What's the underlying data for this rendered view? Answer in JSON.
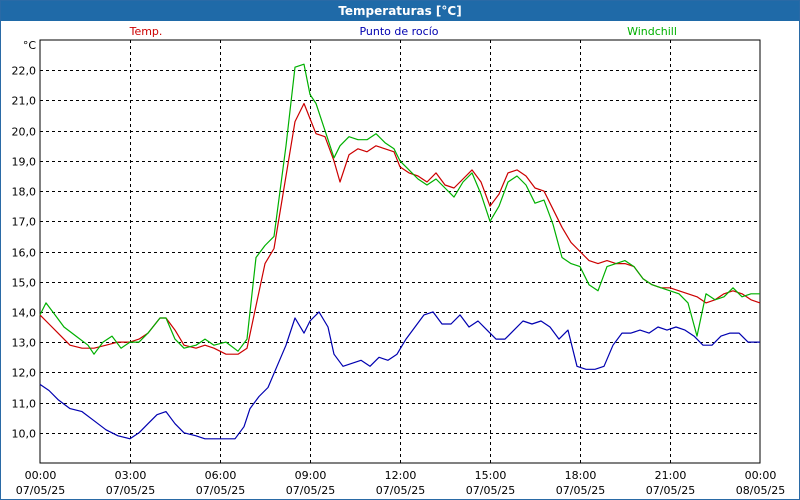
{
  "window": {
    "title": "Temperaturas [°C]"
  },
  "chart_data": {
    "type": "line",
    "title": "Temperaturas [°C]",
    "unit_label": "°C",
    "xlim": [
      0,
      24
    ],
    "ylim": [
      9.0,
      23.0
    ],
    "y_ticks": [
      10.0,
      11.0,
      12.0,
      13.0,
      14.0,
      15.0,
      16.0,
      17.0,
      18.0,
      19.0,
      20.0,
      21.0,
      22.0
    ],
    "y_tick_labels": [
      "10,0",
      "11,0",
      "12,0",
      "13,0",
      "14,0",
      "15,0",
      "16,0",
      "17,0",
      "18,0",
      "19,0",
      "20,0",
      "21,0",
      "22,0"
    ],
    "x_ticks": [
      0,
      3,
      6,
      9,
      12,
      15,
      18,
      21,
      24
    ],
    "x_tick_labels": [
      [
        "00:00",
        "07/05/25"
      ],
      [
        "03:00",
        "07/05/25"
      ],
      [
        "06:00",
        "07/05/25"
      ],
      [
        "09:00",
        "07/05/25"
      ],
      [
        "12:00",
        "07/05/25"
      ],
      [
        "15:00",
        "07/05/25"
      ],
      [
        "18:00",
        "07/05/25"
      ],
      [
        "21:00",
        "07/05/25"
      ],
      [
        "00:00",
        "08/05/25"
      ]
    ],
    "grid": true,
    "legend_position": "top",
    "series": [
      {
        "name": "Temp.",
        "color": "#cc0000",
        "x": [
          0,
          0.3,
          0.6,
          1.0,
          1.4,
          1.8,
          2.2,
          2.6,
          3.0,
          3.3,
          3.6,
          4.0,
          4.2,
          4.5,
          4.8,
          5.2,
          5.5,
          5.8,
          6.2,
          6.6,
          6.9,
          7.2,
          7.5,
          7.8,
          8.2,
          8.5,
          8.8,
          9.0,
          9.2,
          9.5,
          9.8,
          10.0,
          10.3,
          10.6,
          10.9,
          11.2,
          11.5,
          11.8,
          12.0,
          12.3,
          12.6,
          12.9,
          13.2,
          13.5,
          13.8,
          14.1,
          14.4,
          14.7,
          15.0,
          15.3,
          15.6,
          15.9,
          16.2,
          16.5,
          16.8,
          17.1,
          17.4,
          17.7,
          18.0,
          18.3,
          18.6,
          18.9,
          19.2,
          19.5,
          19.8,
          20.1,
          20.4,
          20.7,
          21.0,
          21.3,
          21.6,
          21.9,
          22.2,
          22.5,
          22.8,
          23.1,
          23.4,
          23.7,
          24.0
        ],
        "values": [
          13.9,
          13.6,
          13.3,
          12.9,
          12.8,
          12.8,
          12.9,
          13.0,
          13.0,
          13.1,
          13.3,
          13.8,
          13.8,
          13.4,
          12.9,
          12.8,
          12.9,
          12.8,
          12.6,
          12.6,
          12.8,
          14.2,
          15.6,
          16.1,
          18.5,
          20.3,
          20.9,
          20.4,
          19.9,
          19.8,
          19.0,
          18.3,
          19.2,
          19.4,
          19.3,
          19.5,
          19.4,
          19.3,
          18.8,
          18.6,
          18.5,
          18.3,
          18.6,
          18.2,
          18.1,
          18.4,
          18.7,
          18.3,
          17.5,
          17.9,
          18.6,
          18.7,
          18.5,
          18.1,
          18.0,
          17.4,
          16.8,
          16.3,
          16.0,
          15.7,
          15.6,
          15.7,
          15.6,
          15.6,
          15.5,
          15.1,
          14.9,
          14.8,
          14.8,
          14.7,
          14.6,
          14.5,
          14.3,
          14.4,
          14.6,
          14.7,
          14.6,
          14.4,
          14.3
        ]
      },
      {
        "name": "Punto de rocío",
        "color": "#0000b0",
        "x": [
          0,
          0.3,
          0.6,
          1.0,
          1.4,
          1.8,
          2.2,
          2.6,
          3.0,
          3.3,
          3.6,
          3.9,
          4.2,
          4.5,
          4.8,
          5.2,
          5.5,
          5.8,
          6.2,
          6.5,
          6.8,
          7.0,
          7.3,
          7.6,
          7.9,
          8.2,
          8.5,
          8.8,
          9.0,
          9.3,
          9.6,
          9.8,
          10.1,
          10.4,
          10.7,
          11.0,
          11.3,
          11.6,
          11.9,
          12.2,
          12.5,
          12.8,
          13.1,
          13.4,
          13.7,
          14.0,
          14.3,
          14.6,
          14.9,
          15.2,
          15.5,
          15.8,
          16.1,
          16.4,
          16.7,
          17.0,
          17.3,
          17.6,
          17.9,
          18.2,
          18.5,
          18.8,
          19.1,
          19.4,
          19.7,
          20.0,
          20.3,
          20.6,
          20.9,
          21.2,
          21.5,
          21.8,
          22.1,
          22.4,
          22.7,
          23.0,
          23.3,
          23.6,
          24.0
        ],
        "values": [
          11.6,
          11.4,
          11.1,
          10.8,
          10.7,
          10.4,
          10.1,
          9.9,
          9.8,
          10.0,
          10.3,
          10.6,
          10.7,
          10.3,
          10.0,
          9.9,
          9.8,
          9.8,
          9.8,
          9.8,
          10.2,
          10.8,
          11.2,
          11.5,
          12.2,
          12.9,
          13.8,
          13.3,
          13.7,
          14.0,
          13.5,
          12.6,
          12.2,
          12.3,
          12.4,
          12.2,
          12.5,
          12.4,
          12.6,
          13.1,
          13.5,
          13.9,
          14.0,
          13.6,
          13.6,
          13.9,
          13.5,
          13.7,
          13.4,
          13.1,
          13.1,
          13.4,
          13.7,
          13.6,
          13.7,
          13.5,
          13.1,
          13.4,
          12.2,
          12.1,
          12.1,
          12.2,
          12.9,
          13.3,
          13.3,
          13.4,
          13.3,
          13.5,
          13.4,
          13.5,
          13.4,
          13.2,
          12.9,
          12.9,
          13.2,
          13.3,
          13.3,
          13.0,
          13.0
        ]
      },
      {
        "name": "Windchill",
        "color": "#00b000",
        "x": [
          0,
          0.2,
          0.5,
          0.8,
          1.2,
          1.6,
          1.8,
          2.1,
          2.4,
          2.7,
          3.0,
          3.3,
          3.6,
          4.0,
          4.2,
          4.5,
          4.8,
          5.2,
          5.5,
          5.8,
          6.2,
          6.6,
          6.9,
          7.2,
          7.5,
          7.8,
          8.2,
          8.5,
          8.8,
          9.0,
          9.2,
          9.5,
          9.8,
          10.0,
          10.3,
          10.6,
          10.9,
          11.2,
          11.5,
          11.8,
          12.0,
          12.3,
          12.6,
          12.9,
          13.2,
          13.5,
          13.8,
          14.1,
          14.4,
          14.7,
          15.0,
          15.3,
          15.6,
          15.9,
          16.2,
          16.5,
          16.8,
          17.1,
          17.4,
          17.7,
          18.0,
          18.3,
          18.6,
          18.9,
          19.2,
          19.5,
          19.8,
          20.1,
          20.4,
          20.7,
          21.0,
          21.3,
          21.6,
          21.9,
          22.2,
          22.5,
          22.8,
          23.1,
          23.4,
          23.7,
          24.0
        ],
        "values": [
          13.9,
          14.3,
          13.9,
          13.5,
          13.2,
          12.9,
          12.6,
          13.0,
          13.2,
          12.8,
          13.0,
          13.0,
          13.3,
          13.8,
          13.8,
          13.1,
          12.8,
          12.9,
          13.1,
          12.9,
          13.0,
          12.7,
          13.1,
          15.8,
          16.2,
          16.5,
          19.5,
          22.1,
          22.2,
          21.2,
          20.9,
          20.0,
          19.1,
          19.5,
          19.8,
          19.7,
          19.7,
          19.9,
          19.6,
          19.4,
          19.0,
          18.7,
          18.4,
          18.2,
          18.4,
          18.1,
          17.8,
          18.3,
          18.6,
          17.9,
          17.0,
          17.5,
          18.3,
          18.5,
          18.2,
          17.6,
          17.7,
          16.9,
          15.8,
          15.6,
          15.5,
          14.9,
          14.7,
          15.5,
          15.6,
          15.7,
          15.5,
          15.1,
          14.9,
          14.8,
          14.7,
          14.6,
          14.3,
          13.2,
          14.6,
          14.4,
          14.5,
          14.8,
          14.5,
          14.6,
          14.6
        ]
      }
    ]
  }
}
